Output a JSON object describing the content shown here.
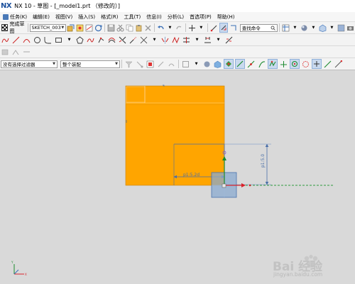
{
  "window": {
    "logo": "NX",
    "title": "NX 10 - 草图 - [_model1.prt （修改的）]"
  },
  "menu": [
    "任务(K)",
    "编辑(E)",
    "视图(V)",
    "插入(S)",
    "格式(R)",
    "工具(T)",
    "信息(I)",
    "分析(L)",
    "首选项(P)",
    "帮助(H)"
  ],
  "toolbar": {
    "finish_sketch_label": "完成草图",
    "sketch_name": "SKETCH_003",
    "command_search_placeholder": "查找命令"
  },
  "filter": {
    "selection_filter": "没有选择过滤器",
    "scope": "整个装配"
  },
  "sketch": {
    "dimension_horizontal": "p1:5.2d",
    "dimension_vertical": "p1:5.0",
    "colors": {
      "body": "#ffa500",
      "dimension": "#4a6fa8",
      "x_axis": "#d9232a",
      "y_axis": "#1a8a2e",
      "datum_square": "#8aa9cf",
      "guide_line": "#2e9a3e"
    }
  },
  "watermark": {
    "brand": "Bai 经验",
    "url": "jingyan.baidu.com"
  }
}
